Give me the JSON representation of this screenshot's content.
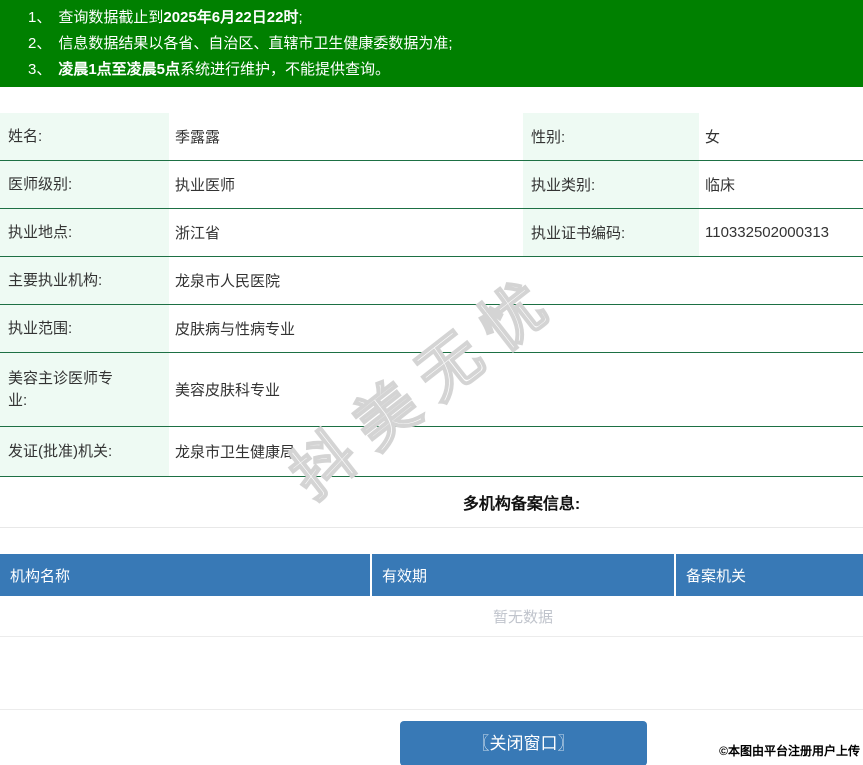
{
  "banner": {
    "lines": [
      {
        "num": "1、",
        "pre": "查询数据截止到",
        "bold": "2025年6月22日22时",
        "post": ";"
      },
      {
        "num": "2、",
        "pre": "信息数据结果以各省、自治区、直辖市卫生健康委数据为准;",
        "bold": "",
        "post": ""
      },
      {
        "num": "3、",
        "pre": "",
        "bold": "凌晨1点至凌晨5点",
        "post": "系统进行维护，不能提供查询。"
      }
    ]
  },
  "info": {
    "rows": [
      {
        "label": "姓名:",
        "value": "季露露",
        "label2": "性别:",
        "value2": "女"
      },
      {
        "label": "医师级别:",
        "value": "执业医师",
        "label2": "执业类别:",
        "value2": "临床"
      },
      {
        "label": "执业地点:",
        "value": "浙江省",
        "label2": "执业证书编码:",
        "value2": "110332502000313"
      },
      {
        "label": "主要执业机构:",
        "value": "龙泉市人民医院"
      },
      {
        "label": "执业范围:",
        "value": "皮肤病与性病专业"
      },
      {
        "label": "美容主诊医师专业:",
        "value": "美容皮肤科专业"
      },
      {
        "label": "发证(批准)机关:",
        "value": "龙泉市卫生健康局"
      }
    ]
  },
  "records_section": {
    "title": "多机构备案信息:",
    "table": {
      "columns": [
        "机构名称",
        "有效期",
        "备案机关"
      ],
      "empty_text": "暂无数据"
    }
  },
  "footer": {
    "close_button_label": "〖关闭窗口〗"
  },
  "watermarks": {
    "diagonal": "抖美无忧",
    "corner": "©本图由平台注册用户上传"
  },
  "colors": {
    "banner_green": "#008000",
    "table_line_green": "#1d7044",
    "label_bg_mint": "#eefaf3",
    "header_blue": "#3879b6",
    "button_blue": "#3879b6",
    "empty_text_grey": "#c0c4cc"
  }
}
